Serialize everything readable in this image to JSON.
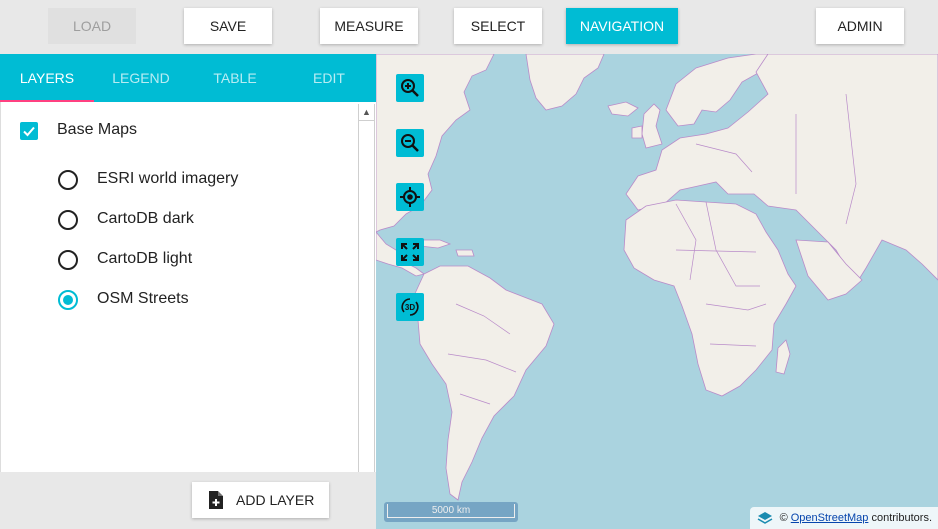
{
  "toolbar": {
    "load": "LOAD",
    "save": "SAVE",
    "measure": "MEASURE",
    "select": "SELECT",
    "navigation": "NAVIGATION",
    "admin": "ADMIN"
  },
  "tabs": {
    "layers": "LAYERS",
    "legend": "LEGEND",
    "table": "TABLE",
    "edit": "EDIT"
  },
  "layers": {
    "group_label": "Base Maps",
    "group_checked": true,
    "base_maps": [
      {
        "label": "ESRI world imagery",
        "selected": false
      },
      {
        "label": "CartoDB dark",
        "selected": false
      },
      {
        "label": "CartoDB light",
        "selected": false
      },
      {
        "label": "OSM Streets",
        "selected": true
      }
    ],
    "add_layer": "ADD LAYER"
  },
  "map": {
    "controls": [
      "zoom-in-icon",
      "zoom-out-icon",
      "locate-icon",
      "fullscreen-icon",
      "3d-rotate-icon"
    ],
    "scale_label": "5000 km",
    "attribution": {
      "prefix": "©",
      "link": "OpenStreetMap",
      "suffix": "contributors."
    },
    "colors": {
      "water": "#aad3df",
      "land": "#f2efe9",
      "border": "#b98bc9"
    }
  },
  "colors": {
    "accent": "#00bcd4",
    "tab_indicator": "#ff4081",
    "toolbar_bg": "#e8e8e8"
  }
}
